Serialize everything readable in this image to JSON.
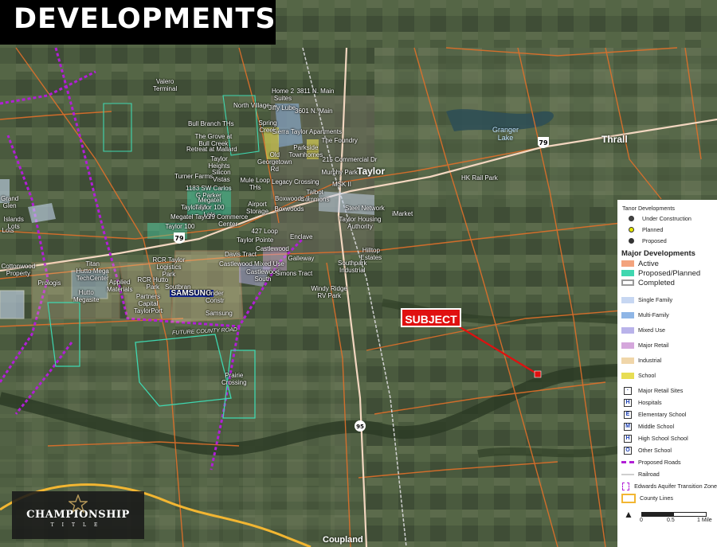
{
  "header": {
    "title": "DEVELOPMENTS"
  },
  "subject": {
    "label": "SUBJECT"
  },
  "towns": {
    "taylor": "Taylor",
    "thrall": "Thrall",
    "granger_lake": "Granger\nLake",
    "coupland": "Coupland"
  },
  "dev_labels": [
    "Valero\nTerminal",
    "Home 2\nSuites",
    "3811 N. Main",
    "North Village",
    "Jiffy Lube",
    "3601 N. Main",
    "Bull Branch THs",
    "Spring\nCreek",
    "Sierra Taylor Apartments",
    "The Grove at\nBull Creek",
    "Parkside\nTownhomes",
    "The Foundry",
    "Retreat at Mallard",
    "Old\nGeorgetown\nRd",
    "215 Commercial Dr",
    "Taylor\nHeights",
    "Murphy Park",
    "Turner Farms",
    "Silicon\nVistas",
    "Mule Loop\nTHs",
    "Legacy Crossing",
    "MSK II",
    "1183 SW Carlos\nG Parker",
    "Talbot\nCommons",
    "Taylor 50",
    "Megatel\nTaylor 100\nLots",
    "Airport\nStorage",
    "Boxwoods II",
    "Boxwoods",
    "Steel Network",
    "Megatel Taylor",
    "79 Commerce\nCenter",
    "Taylor Housing\nAuthority",
    "iMarket",
    "Taylor 100",
    "427 Loop",
    "Taylor Pointe",
    "Enclave",
    "Davis Tract",
    "Castlewood",
    "Hilltop\nEstates",
    "Castlewood Mixed Use",
    "Galleway",
    "Titan\nHutto Mega\nTechCenter",
    "RCR Taylor\nLogistics\nPark",
    "Castlewood\nSouth",
    "Simons Tract",
    "Southpark\nIndustrial",
    "Cottonwood\nProperty",
    "Prologis",
    "Applied\nMaterials",
    "RCR Hutto\nPark",
    "Hutto\nMegasite",
    "Soutbran",
    "SAMSUNG",
    "Under\nConstr",
    "Windy Ridge\nRV Park",
    "Partners\nCapital\nTaylorPort",
    "Samsung",
    "FUTURE COUNTY ROAD",
    "Prairie\nCrossing",
    "HK Rail Park",
    "Lots",
    "Islands\nLots",
    "Grand\nGlen"
  ],
  "highway_shields": {
    "us79": "79",
    "tx95": "95"
  },
  "legend": {
    "taylor_devs_title": "Tanor Developments",
    "taylor_devs": [
      {
        "label": "Under Construction",
        "color": "#444444"
      },
      {
        "label": "Planned",
        "color": "#e8e800"
      },
      {
        "label": "Proposed",
        "color": "#333333"
      }
    ],
    "major_title": "Major Developments",
    "major": [
      {
        "label": "Active",
        "color": "#f3a37d"
      },
      {
        "label": "Proposed/Planned",
        "color": "#3fd7b0"
      },
      {
        "label": "Completed",
        "color": "#ffffff"
      }
    ],
    "types": [
      {
        "label": "Single Family",
        "color": "#c7d7f2"
      },
      {
        "label": "Multi-Family",
        "color": "#8fb6e6"
      },
      {
        "label": "Mixed Use",
        "color": "#b9b3ea"
      },
      {
        "label": "Major Retail",
        "color": "#d5a7dc"
      },
      {
        "label": "Industrial",
        "color": "#f0d6a9"
      },
      {
        "label": "School",
        "color": "#e7dd54"
      }
    ],
    "symbols": [
      {
        "label": "Major Retail Sites",
        "glyph": "·"
      },
      {
        "label": "Hospitals",
        "glyph": "H"
      },
      {
        "label": "Elementary School",
        "glyph": "E"
      },
      {
        "label": "Middle School",
        "glyph": "M"
      },
      {
        "label": "High School School",
        "glyph": "H"
      },
      {
        "label": "Other School",
        "glyph": "O"
      }
    ],
    "lines": [
      {
        "label": "Proposed Roads",
        "color": "#b11fd6"
      },
      {
        "label": "Railroad",
        "color": "#cfcfcf"
      },
      {
        "label": "Edwards Aquifer Transition Zone",
        "color": "#b11fd6"
      },
      {
        "label": "County Lines",
        "color": "#f2b632"
      }
    ],
    "scale": [
      "0",
      "0.5",
      "1 Mile"
    ]
  },
  "logo": {
    "name": "CHAMPIONSHIP",
    "sub": "TITLE"
  },
  "colors": {
    "accent_red": "#e01010",
    "road_orange": "#e0702a",
    "proposed_road": "#b11fd6",
    "county_line": "#f2b632"
  }
}
